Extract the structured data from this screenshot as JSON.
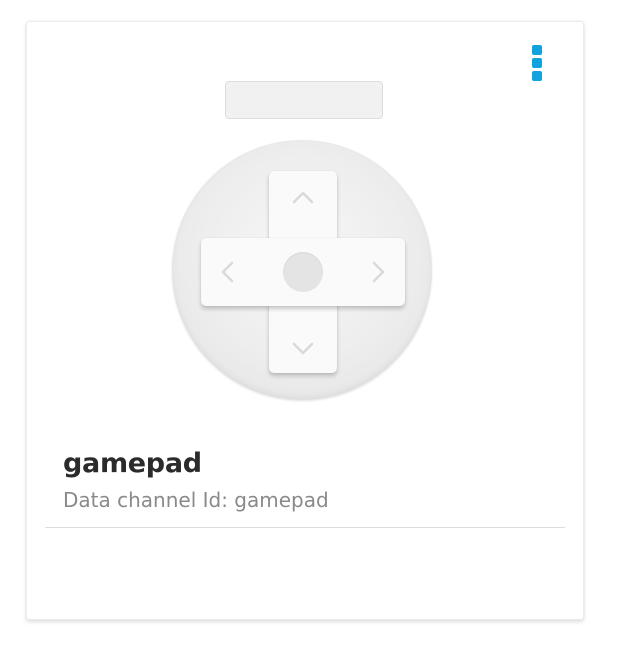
{
  "widget": {
    "title": "gamepad",
    "subtitle": "Data channel Id: gamepad",
    "menu_icon": "vertical-dots-icon",
    "label_box_text": ""
  },
  "gamepad": {
    "arrows": [
      "chevron-up-icon",
      "chevron-down-icon",
      "chevron-left-icon",
      "chevron-right-icon"
    ]
  },
  "colors": {
    "accent": "#10a3de",
    "title": "#2b2b2b",
    "subtitle": "#8a8a8a"
  }
}
